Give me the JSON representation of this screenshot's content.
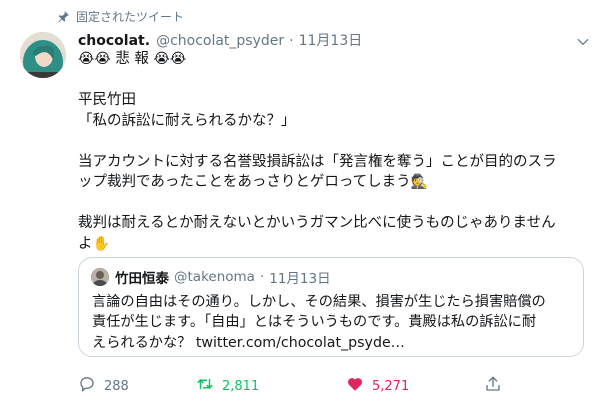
{
  "pinned_label": "固定されたツイート",
  "tweet": {
    "display_name": "chocolat.",
    "handle": "@chocolat_psyder",
    "separator": "·",
    "date": "11月13日",
    "line1_emoji_a": "😭😭",
    "line1_text": " 悲 報 ",
    "line1_emoji_b": "😭😭",
    "line2": "平民竹田",
    "line3": "「私の訴訟に耐えられるかな？」",
    "line4": "当アカウントに対する名誉毀損訴訟は「発言権を奪う」ことが目的のスラ",
    "line5_text": "ップ裁判であったことをあっさりとゲロってしまう",
    "line5_emoji": "🕵",
    "line6": "裁判は耐えるとか耐えないとかいうガマン比べに使うものじゃありません",
    "line7_text": "よ",
    "line7_emoji": "✋"
  },
  "quote": {
    "display_name": "竹田恒泰",
    "handle": "@takenoma",
    "separator": "·",
    "date": "11月13日",
    "line1": "言論の自由はその通り。しかし、その結果、損害が生じたら損害賠償の",
    "line2": "責任が生じます。「自由」とはそういうものです。貴殿は私の訴訟に耐",
    "line3": "えられるかな？ twitter.com/chocolat_psyde…"
  },
  "actions": {
    "replies": "288",
    "retweets": "2,811",
    "likes": "5,271"
  },
  "colors": {
    "secondary_text": "#657786",
    "retweet_green": "#17bf63",
    "like_red": "#e0245e",
    "border": "#ccd6dd"
  }
}
